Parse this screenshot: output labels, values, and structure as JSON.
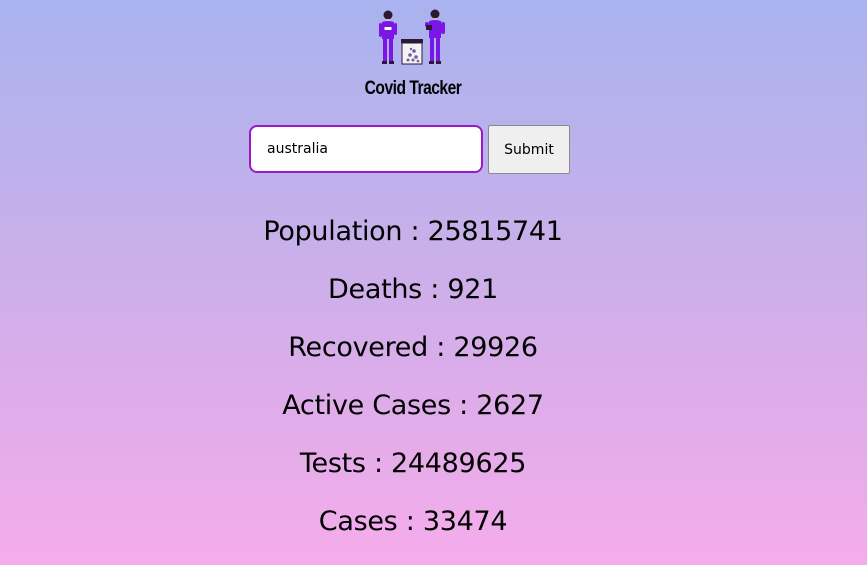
{
  "header": {
    "logo_icon": "two-people-with-covid-test-kit-icon",
    "title": "Covid Tracker"
  },
  "search": {
    "value": "australia",
    "placeholder": "",
    "submit_label": "Submit"
  },
  "stats": [
    {
      "label": "Population",
      "value": "25815741"
    },
    {
      "label": "Deaths",
      "value": "921"
    },
    {
      "label": "Recovered",
      "value": "29926"
    },
    {
      "label": "Active Cases",
      "value": "2627"
    },
    {
      "label": "Tests",
      "value": "24489625"
    },
    {
      "label": "Cases",
      "value": "33474"
    }
  ],
  "colors": {
    "gradient_top": "#a9b3ef",
    "gradient_bottom": "#f5aceb",
    "input_border": "#9b18c8",
    "figure_purple": "#7b16e6"
  }
}
